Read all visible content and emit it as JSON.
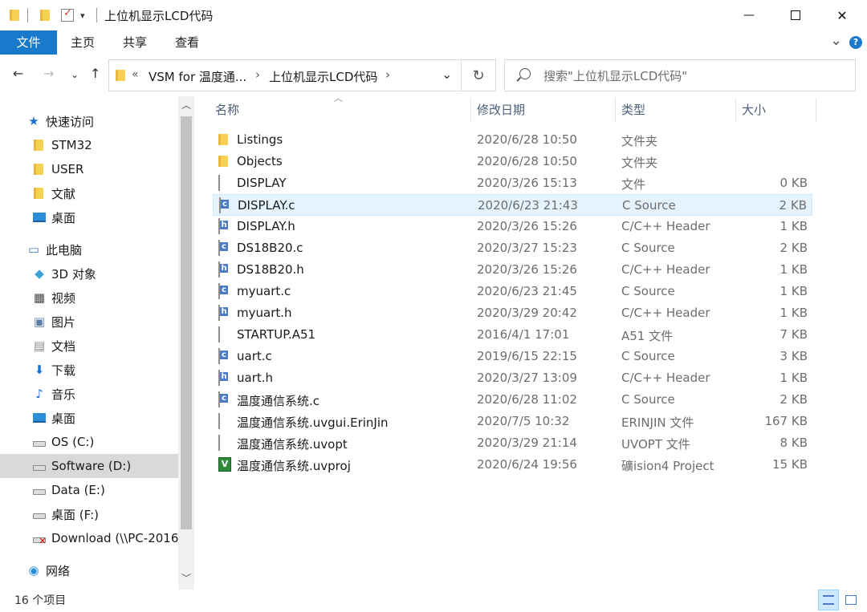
{
  "window": {
    "title": "上位机显示LCD代码",
    "minimize_glyph": "—",
    "maximize_glyph": "☐",
    "close_glyph": "✕"
  },
  "ribbon": {
    "tabs": [
      "文件",
      "主页",
      "共享",
      "查看"
    ],
    "expand_glyph": "⌄",
    "help_glyph": "?"
  },
  "address": {
    "crumbs": [
      "«",
      "VSM for 温度通...",
      "›",
      "上位机显示LCD代码",
      "›"
    ],
    "search_placeholder": "搜索\"上位机显示LCD代码\""
  },
  "nav": {
    "items": [
      {
        "label": "快速访问",
        "icon": "star-icon",
        "level": 0
      },
      {
        "label": "STM32",
        "icon": "folder-icon",
        "level": 1
      },
      {
        "label": "USER",
        "icon": "folder-icon",
        "level": 1
      },
      {
        "label": "文献",
        "icon": "folder-icon",
        "level": 1
      },
      {
        "label": "桌面",
        "icon": "desktop-icon",
        "level": 1
      },
      {
        "label": "此电脑",
        "icon": "computer-icon",
        "level": 0
      },
      {
        "label": "3D 对象",
        "icon": "cube-icon",
        "level": 1
      },
      {
        "label": "视频",
        "icon": "video-icon",
        "level": 1
      },
      {
        "label": "图片",
        "icon": "picture-icon",
        "level": 1
      },
      {
        "label": "文档",
        "icon": "document-icon",
        "level": 1
      },
      {
        "label": "下载",
        "icon": "download-icon",
        "level": 1
      },
      {
        "label": "音乐",
        "icon": "music-icon",
        "level": 1
      },
      {
        "label": "桌面",
        "icon": "desktop-icon",
        "level": 1
      },
      {
        "label": "OS (C:)",
        "icon": "windows-drive-icon",
        "level": 1
      },
      {
        "label": "Software (D:)",
        "icon": "drive-icon",
        "level": 1,
        "selected": true
      },
      {
        "label": "Data (E:)",
        "icon": "drive-icon",
        "level": 1
      },
      {
        "label": "桌面 (F:)",
        "icon": "drive-icon",
        "level": 1
      },
      {
        "label": "Download (\\\\PC-2016",
        "icon": "network-drive-disconnected-icon",
        "level": 1
      },
      {
        "label": "网络",
        "icon": "network-icon",
        "level": 0
      }
    ]
  },
  "columns": {
    "name": "名称",
    "date": "修改日期",
    "type": "类型",
    "size": "大小"
  },
  "files": [
    {
      "name": "Listings",
      "date": "2020/6/28 10:50",
      "type": "文件夹",
      "size": "",
      "icon": "folder-icon"
    },
    {
      "name": "Objects",
      "date": "2020/6/28 10:50",
      "type": "文件夹",
      "size": "",
      "icon": "folder-icon"
    },
    {
      "name": "DISPLAY",
      "date": "2020/3/26 15:13",
      "type": "文件",
      "size": "0 KB",
      "icon": "blank-file-icon"
    },
    {
      "name": "DISPLAY.c",
      "date": "2020/6/23 21:43",
      "type": "C Source",
      "size": "2 KB",
      "icon": "c-source-icon",
      "hover": true
    },
    {
      "name": "DISPLAY.h",
      "date": "2020/3/26 15:26",
      "type": "C/C++ Header",
      "size": "1 KB",
      "icon": "c-header-icon"
    },
    {
      "name": "DS18B20.c",
      "date": "2020/3/27 15:23",
      "type": "C Source",
      "size": "2 KB",
      "icon": "c-source-icon"
    },
    {
      "name": "DS18B20.h",
      "date": "2020/3/26 15:26",
      "type": "C/C++ Header",
      "size": "1 KB",
      "icon": "c-header-icon"
    },
    {
      "name": "myuart.c",
      "date": "2020/6/23 21:45",
      "type": "C Source",
      "size": "1 KB",
      "icon": "c-source-icon"
    },
    {
      "name": "myuart.h",
      "date": "2020/3/29 20:42",
      "type": "C/C++ Header",
      "size": "1 KB",
      "icon": "c-header-icon"
    },
    {
      "name": "STARTUP.A51",
      "date": "2016/4/1 17:01",
      "type": "A51 文件",
      "size": "7 KB",
      "icon": "blank-file-icon"
    },
    {
      "name": "uart.c",
      "date": "2019/6/15 22:15",
      "type": "C Source",
      "size": "3 KB",
      "icon": "c-source-icon"
    },
    {
      "name": "uart.h",
      "date": "2020/3/27 13:09",
      "type": "C/C++ Header",
      "size": "1 KB",
      "icon": "c-header-icon"
    },
    {
      "name": "温度通信系统.c",
      "date": "2020/6/28 11:02",
      "type": "C Source",
      "size": "2 KB",
      "icon": "c-source-icon"
    },
    {
      "name": "温度通信系统.uvgui.ErinJin",
      "date": "2020/7/5 10:32",
      "type": "ERINJIN 文件",
      "size": "167 KB",
      "icon": "blank-file-icon"
    },
    {
      "name": "温度通信系统.uvopt",
      "date": "2020/3/29 21:14",
      "type": "UVOPT 文件",
      "size": "8 KB",
      "icon": "blank-file-icon"
    },
    {
      "name": "温度通信系统.uvproj",
      "date": "2020/6/24 19:56",
      "type": "礦ision4 Project",
      "size": "15 KB",
      "icon": "uvision-project-icon"
    }
  ],
  "status": {
    "item_count": "16 个项目"
  }
}
